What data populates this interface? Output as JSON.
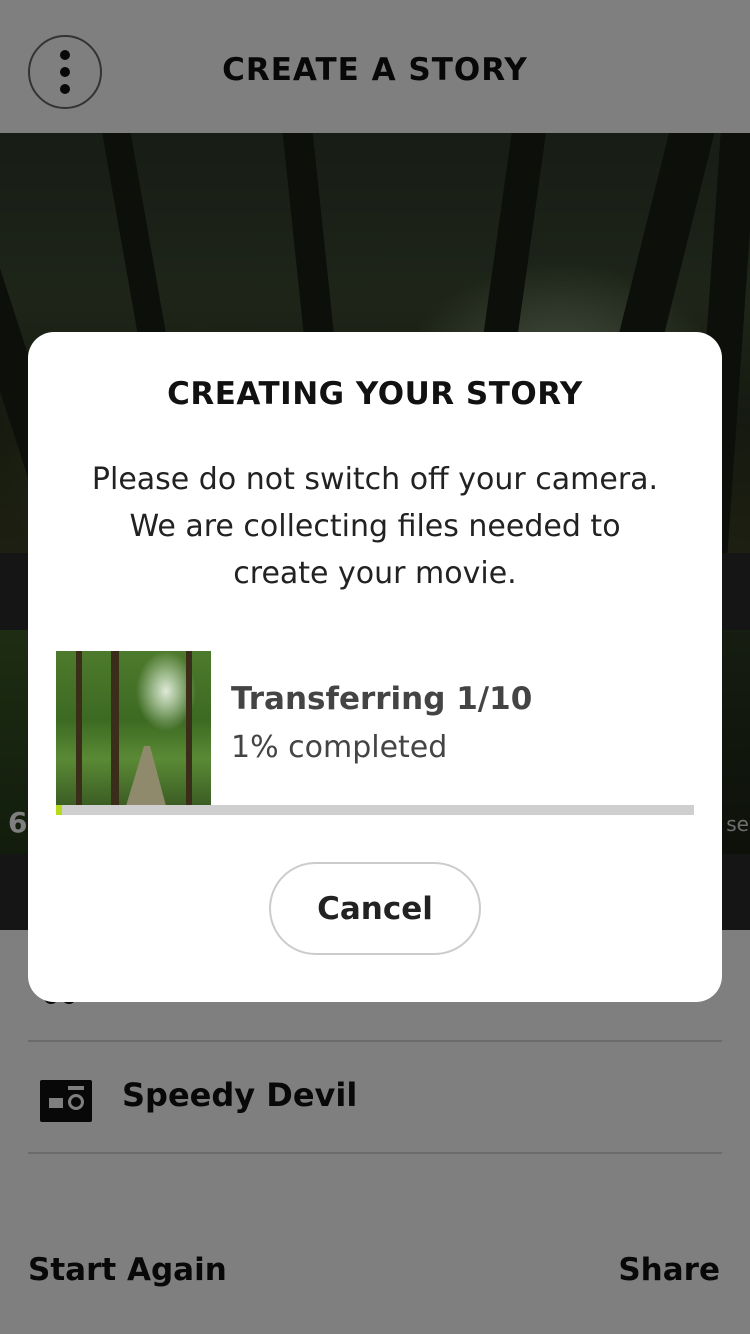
{
  "header": {
    "title": "CREATE A STORY",
    "menu_icon": "more-vertical-icon"
  },
  "thumbnail_strip": {
    "left_label": "6",
    "right_label": "sec"
  },
  "list": {
    "items": [
      {
        "label": "Speedy Devil",
        "icon": "video-camera-icon"
      }
    ]
  },
  "footer": {
    "start_again_label": "Start Again",
    "share_label": "Share"
  },
  "dialog": {
    "title": "CREATING YOUR STORY",
    "message": "Please do not switch off your camera. We are collecting files needed to create your movie.",
    "transfer": {
      "title": "Transferring 1/10",
      "status": "1% completed",
      "progress_percent": 1
    },
    "cancel_label": "Cancel"
  },
  "colors": {
    "progress_fill": "#b6d91a",
    "progress_track": "#cfcfcf",
    "scrim": "rgba(0,0,0,0.5)"
  }
}
